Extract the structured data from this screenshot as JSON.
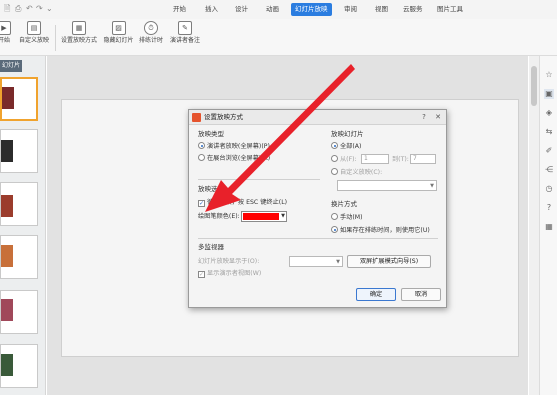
{
  "tabs": [
    {
      "label": "开始",
      "active": false
    },
    {
      "label": "插入",
      "active": false
    },
    {
      "label": "设计",
      "active": false
    },
    {
      "label": "动画",
      "active": false
    },
    {
      "label": "幻灯片放映",
      "active": true
    },
    {
      "label": "审阅",
      "active": false
    },
    {
      "label": "视图",
      "active": false
    },
    {
      "label": "云服务",
      "active": false
    },
    {
      "label": "图片工具",
      "active": false
    }
  ],
  "ribbon": {
    "from_start": "开始",
    "custom_show": "自定义放映",
    "setup_show": "设置放映方式",
    "hide_slide": "隐藏幻灯片",
    "rehearse_timings": "排练计时",
    "speaker_notes": "演讲者备注"
  },
  "left_panel": {
    "tab_label": "幻灯片"
  },
  "dialog": {
    "title": "设置放映方式",
    "show_type": {
      "heading": "放映类型",
      "speaker": "演讲者放映(全屏幕)(P)",
      "kiosk": "在展台浏览(全屏幕)(K)"
    },
    "show_slides": {
      "heading": "放映幻灯片",
      "all": "全部(A)",
      "from": "从(F):",
      "from_value": "1",
      "to": "到(T):",
      "to_value": "7",
      "custom": "自定义放映(C):"
    },
    "show_options": {
      "heading": "放映选项",
      "loop": "循环放映，按 ESC 键终止(L)",
      "pen_color": "绘图笔颜色(E):",
      "pen_color_value": "#ff0000"
    },
    "advance": {
      "heading": "换片方式",
      "manual": "手动(M)",
      "timings": "如果存在排练时间，则使用它(U)"
    },
    "monitors": {
      "heading": "多监视器",
      "show_on": "幻灯片放映显示于(O):",
      "dual_screen_button": "双屏扩展模式向导(S)",
      "presenter_view": "显示演示者视图(W)"
    },
    "ok": "确定",
    "cancel": "取消"
  },
  "colors": {
    "accent": "#2b7de0",
    "arrow": "#e8212a",
    "selection": "#f0a32e",
    "dialog_icon": "#e5532d"
  }
}
